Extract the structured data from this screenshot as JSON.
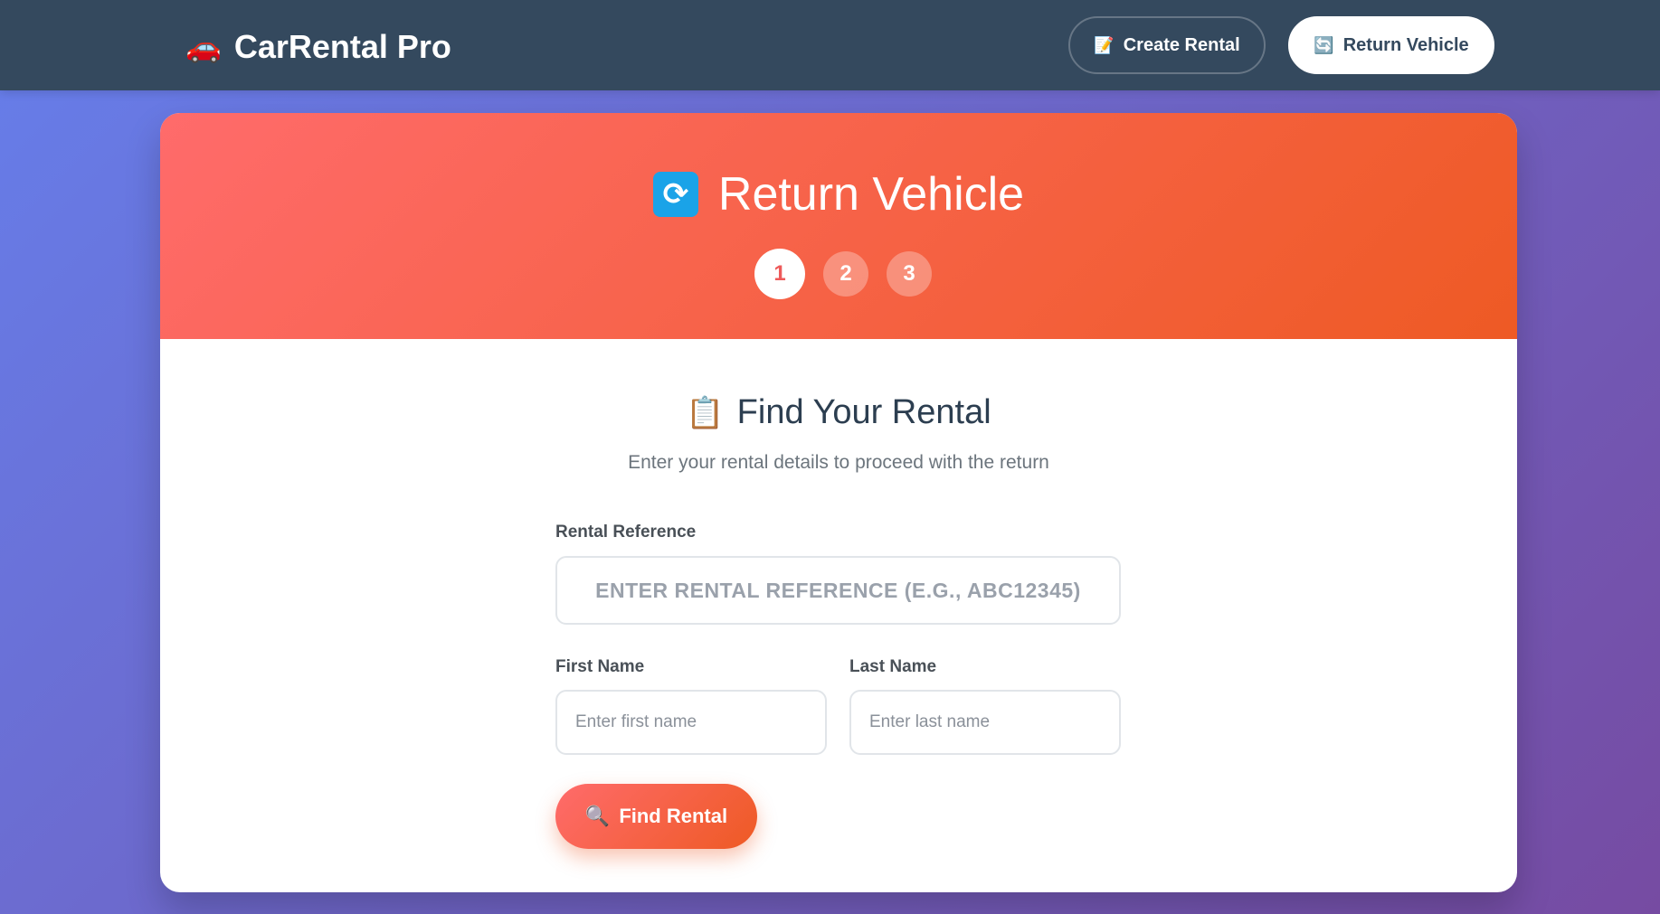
{
  "app": {
    "brand": "CarRental Pro",
    "brand_icon": "🚗"
  },
  "nav": {
    "create_label": "Create Rental",
    "create_icon": "📝",
    "return_label": "Return Vehicle",
    "return_icon": "🔄"
  },
  "header": {
    "title": "Return Vehicle",
    "title_icon": "🔄",
    "steps": [
      "1",
      "2",
      "3"
    ],
    "active_step": 1
  },
  "section": {
    "title": "Find Your Rental",
    "title_icon": "📋",
    "subtitle": "Enter your rental details to proceed with the return"
  },
  "form": {
    "ref_label": "Rental Reference",
    "ref_placeholder": "Enter rental reference (e.g., ABC12345)",
    "first_label": "First Name",
    "first_placeholder": "Enter first name",
    "last_label": "Last Name",
    "last_placeholder": "Enter last name",
    "submit_label": "Find Rental",
    "submit_icon": "🔍"
  },
  "colors": {
    "navbar": "#34495e",
    "accent_start": "#ff6b6b",
    "accent_end": "#ee5a24",
    "bg_start": "#667eea",
    "bg_end": "#764ba2"
  }
}
